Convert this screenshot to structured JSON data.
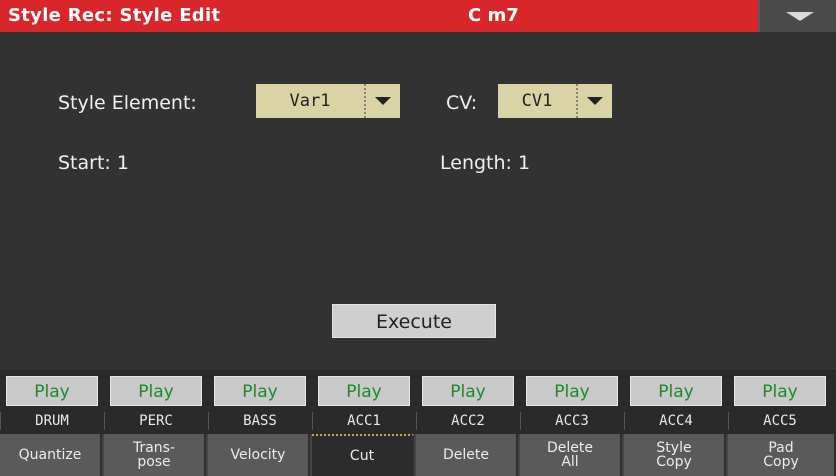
{
  "header": {
    "title": "Style Rec: Style Edit",
    "chord": "C m7",
    "menu_icon": "triangle-down-icon"
  },
  "form": {
    "style_element_label": "Style Element:",
    "style_element_value": "Var1",
    "cv_label": "CV:",
    "cv_value": "CV1",
    "start_label": "Start: 1",
    "length_label": "Length: 1",
    "execute_label": "Execute"
  },
  "tracks": [
    {
      "play": "Play",
      "name": "DRUM"
    },
    {
      "play": "Play",
      "name": "PERC"
    },
    {
      "play": "Play",
      "name": "BASS"
    },
    {
      "play": "Play",
      "name": "ACC1"
    },
    {
      "play": "Play",
      "name": "ACC2"
    },
    {
      "play": "Play",
      "name": "ACC3"
    },
    {
      "play": "Play",
      "name": "ACC4"
    },
    {
      "play": "Play",
      "name": "ACC5"
    }
  ],
  "tabs": [
    {
      "label": "Quantize"
    },
    {
      "label": "Trans-\npose"
    },
    {
      "label": "Velocity"
    },
    {
      "label": "Cut",
      "active": true
    },
    {
      "label": "Delete"
    },
    {
      "label": "Delete\nAll"
    },
    {
      "label": "Style\nCopy"
    },
    {
      "label": "Pad\nCopy"
    }
  ],
  "colors": {
    "header_bg": "#d8262b",
    "play_text": "#1c8a2a",
    "dropdown_bg": "#d9d3a6"
  }
}
